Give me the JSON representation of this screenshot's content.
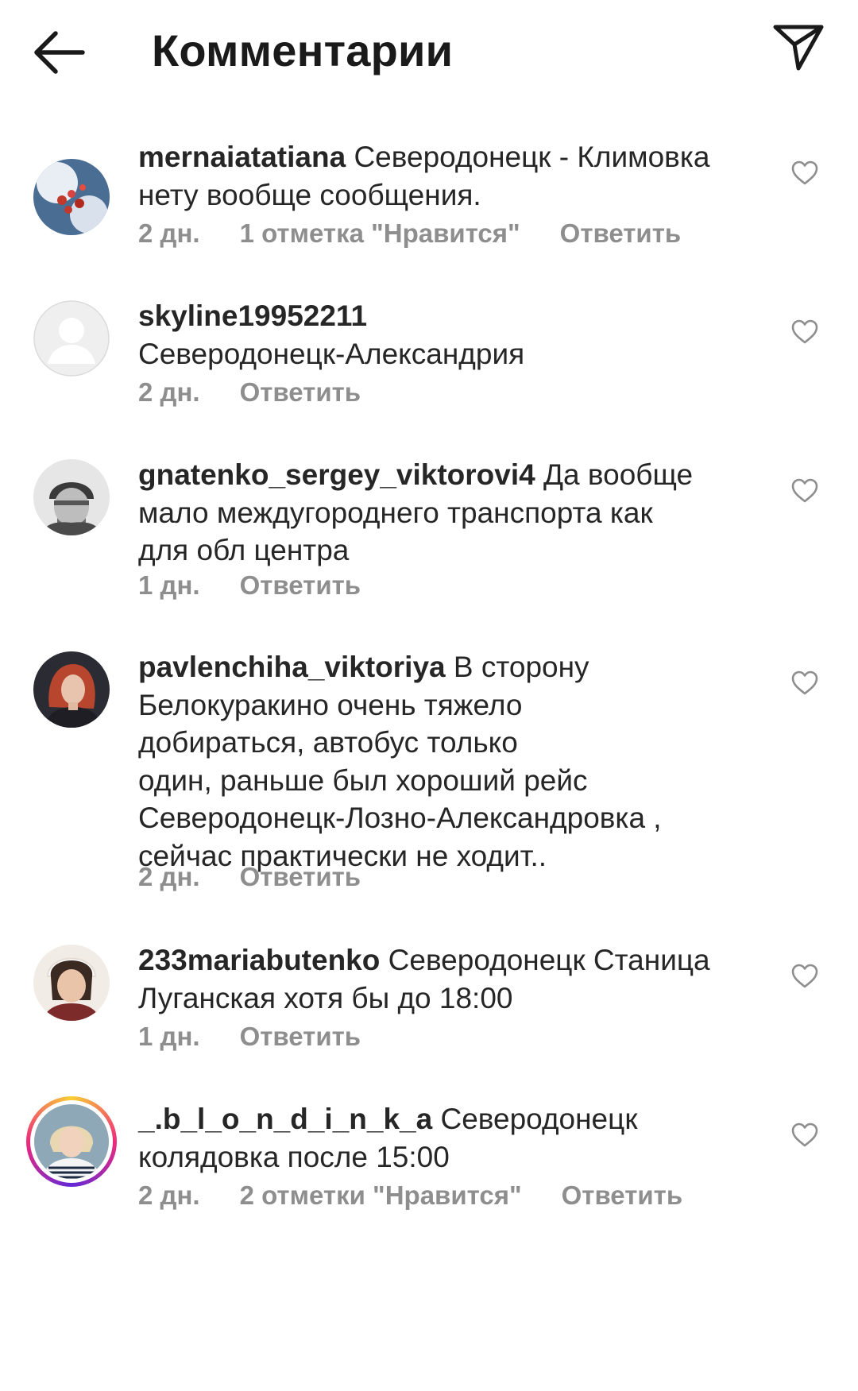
{
  "header": {
    "title": "Комментарии",
    "back_icon": "arrow-left-icon",
    "share_icon": "paper-plane-icon"
  },
  "colors": {
    "text": "#262626",
    "meta": "#8e8e8e",
    "story_ring": [
      "#f9ce34",
      "#ee2a7b",
      "#6228d7"
    ]
  },
  "comments": [
    {
      "username": "mernaiatatiana",
      "text": "Северодонецк - Климовка\nнету вообще сообщения.",
      "time": "2 дн.",
      "likes": "1 отметка \"Нравится\"",
      "reply": "Ответить"
    },
    {
      "username": "skyline19952211",
      "text": "\nСеверодонецк-Александрия",
      "time": "2 дн.",
      "reply": "Ответить"
    },
    {
      "username": "gnatenko_sergey_viktorovi4",
      "text": "Да вообще\nмало междугороднего транспорта как\nдля обл центра",
      "time": "1 дн.",
      "reply": "Ответить"
    },
    {
      "username": "pavlenchiha_viktoriya",
      "text": "В сторону\nБелокуракино  очень тяжело\nдобираться, автобус только\nодин, раньше  был хороший  рейс\nСеверодонецк-Лозно-Александровка ,\nсейчас  практически  не ходит..",
      "time": "2 дн.",
      "reply": "Ответить"
    },
    {
      "username": "233mariabutenko",
      "text": "Северодонецк Станица\nЛуганская хотя бы до 18:00",
      "time": "1 дн.",
      "reply": "Ответить"
    },
    {
      "username": "_.b_l_o_n_d_i_n_k_a",
      "text": "Северодонецк\nколядовка после 15:00",
      "time": "2 дн.",
      "likes": "2 отметки \"Нравится\"",
      "reply": "Ответить"
    }
  ]
}
